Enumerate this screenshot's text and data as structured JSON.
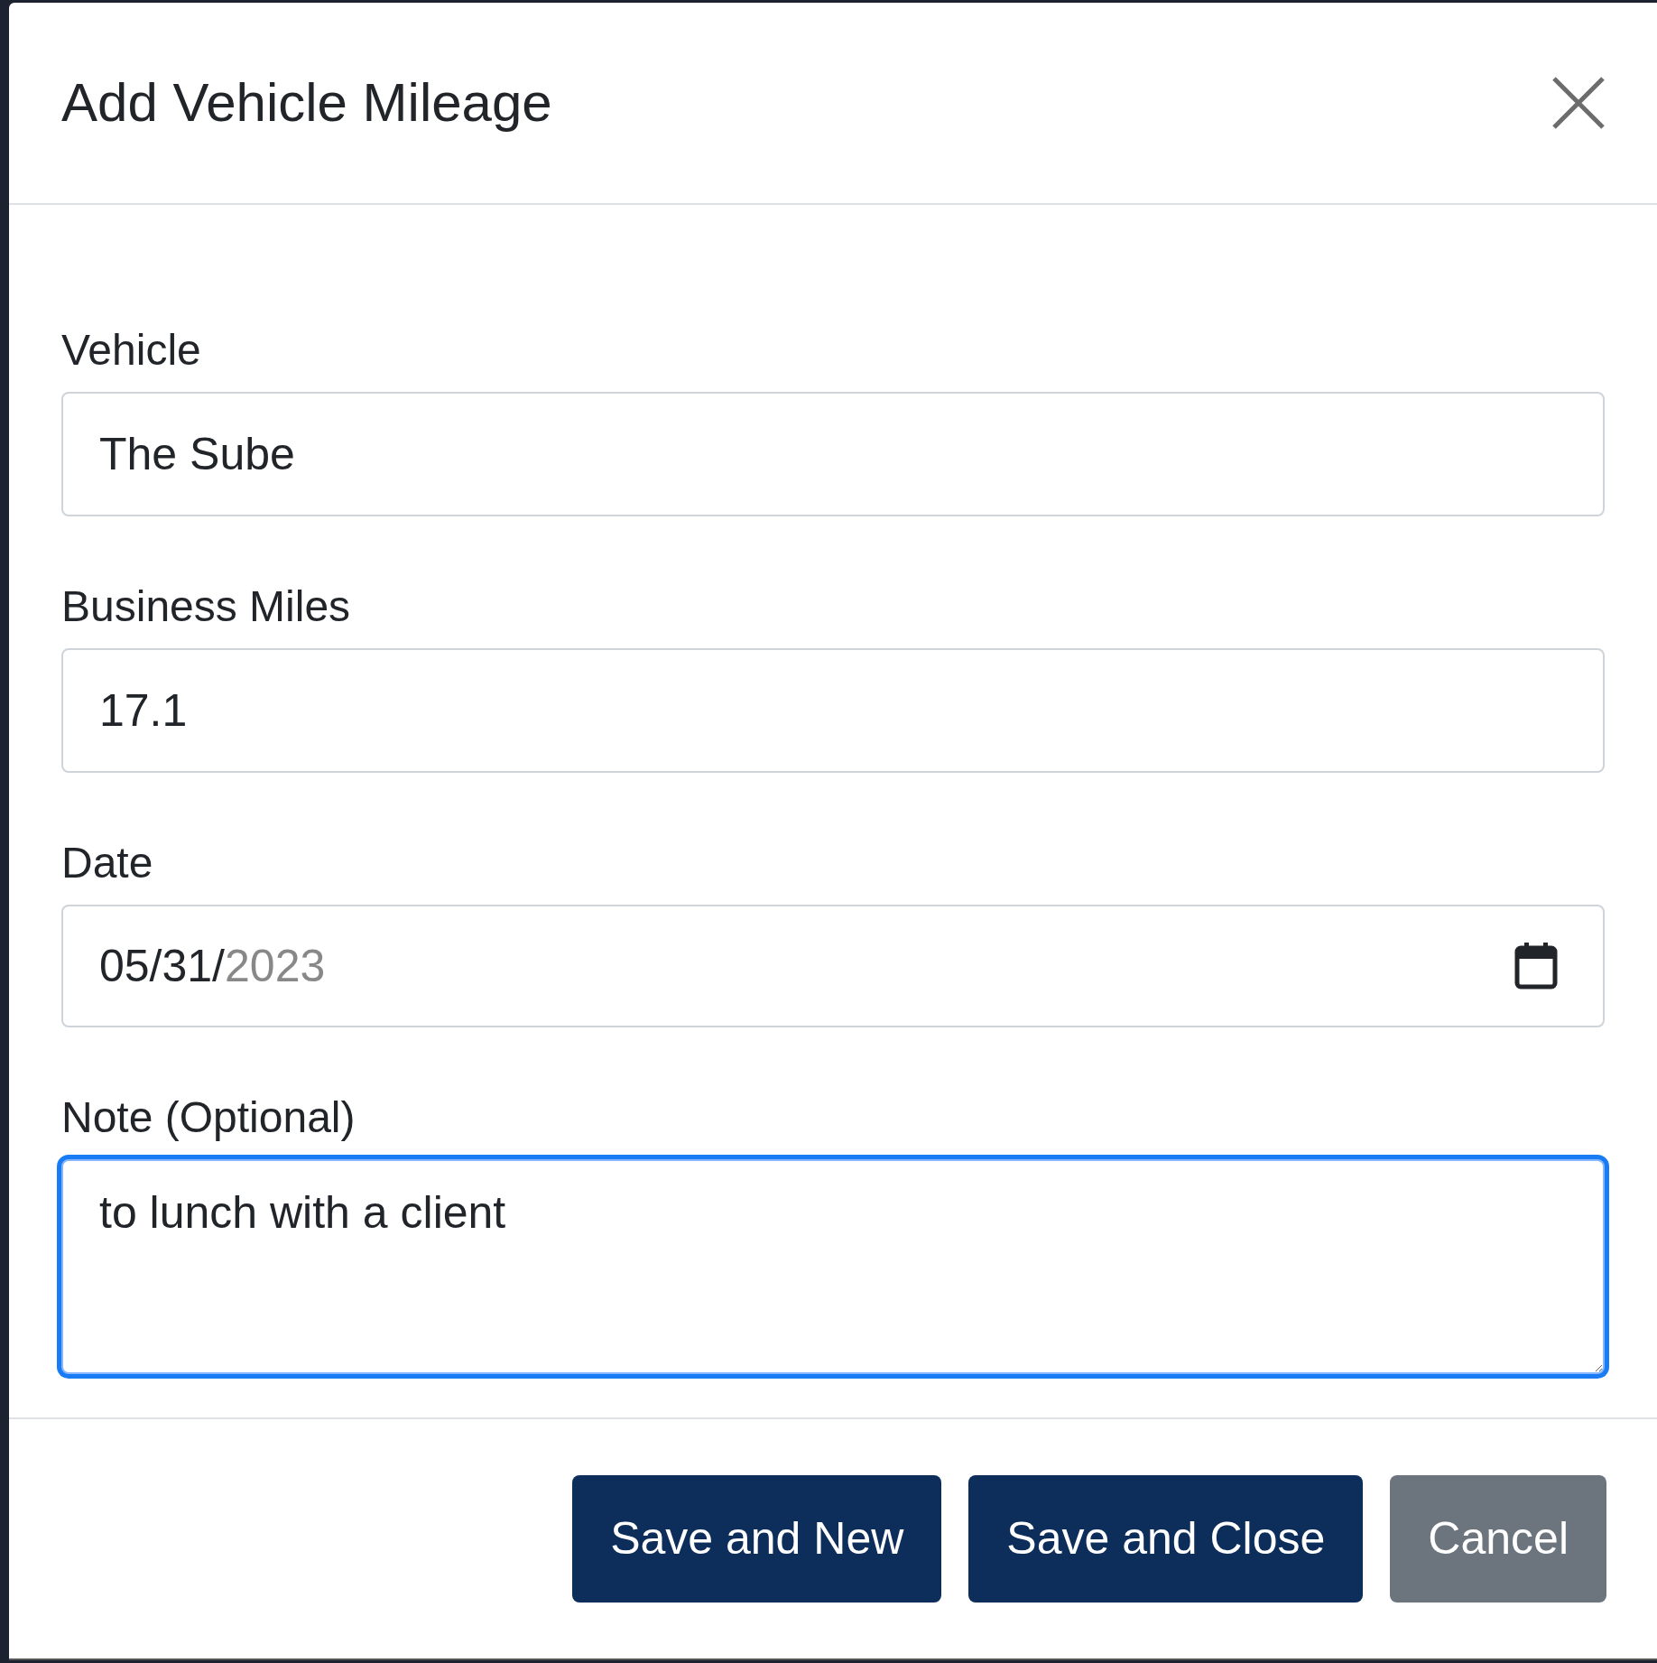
{
  "dialog": {
    "title": "Add Vehicle Mileage"
  },
  "fields": [
    {
      "kind": "text",
      "label": "Vehicle",
      "value": "The Sube"
    },
    {
      "kind": "text",
      "label": "Business Miles",
      "value": "17.1"
    },
    {
      "kind": "date",
      "label": "Date",
      "value": "05/31/",
      "pending": "2023"
    },
    {
      "kind": "textarea",
      "label": "Note (Optional)",
      "value": "to lunch with a client",
      "focused": true
    }
  ],
  "buttons": [
    {
      "label": "Save and New",
      "kind": "primary"
    },
    {
      "label": "Save and Close",
      "kind": "primary"
    },
    {
      "label": "Cancel",
      "kind": "secondary"
    }
  ]
}
